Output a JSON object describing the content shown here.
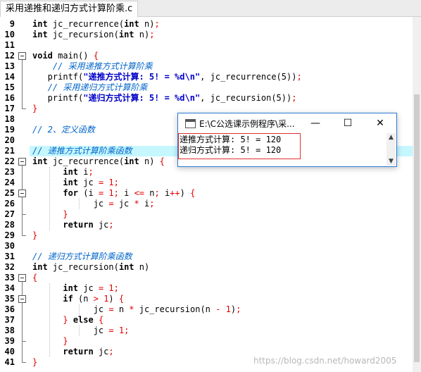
{
  "tab": {
    "title": "采用递推和递归方式计算阶乘.c"
  },
  "code_lines": [
    {
      "n": "9",
      "segs": [
        [
          "kw",
          "int"
        ],
        [
          "t",
          " jc_recurrence("
        ],
        [
          "kw",
          "int"
        ],
        [
          "t",
          " n)"
        ],
        [
          "op",
          ";"
        ]
      ]
    },
    {
      "n": "10",
      "segs": [
        [
          "kw",
          "int"
        ],
        [
          "t",
          " jc_recursion("
        ],
        [
          "kw",
          "int"
        ],
        [
          "t",
          " n)"
        ],
        [
          "op",
          ";"
        ]
      ]
    },
    {
      "n": "11",
      "segs": []
    },
    {
      "n": "12",
      "segs": [
        [
          "kw",
          "void"
        ],
        [
          "t",
          " main() "
        ],
        [
          "op",
          "{"
        ]
      ]
    },
    {
      "n": "13",
      "segs": [
        [
          "t",
          "    "
        ],
        [
          "cmt",
          "// 采用递推方式计算阶乘"
        ]
      ]
    },
    {
      "n": "14",
      "segs": [
        [
          "t",
          "   printf("
        ],
        [
          "str",
          "\"递推方式计算: 5! = %d\\n\""
        ],
        [
          "t",
          ", jc_recurrence(5))"
        ],
        [
          "op",
          ";"
        ]
      ]
    },
    {
      "n": "15",
      "segs": [
        [
          "t",
          "   "
        ],
        [
          "cmt",
          "// 采用递归方式计算阶乘"
        ]
      ]
    },
    {
      "n": "16",
      "segs": [
        [
          "t",
          "   printf("
        ],
        [
          "str",
          "\"递归方式计算: 5! = %d\\n\""
        ],
        [
          "t",
          ", jc_recursion(5))"
        ],
        [
          "op",
          ";"
        ]
      ]
    },
    {
      "n": "17",
      "segs": [
        [
          "op",
          "}"
        ]
      ]
    },
    {
      "n": "18",
      "segs": []
    },
    {
      "n": "19",
      "segs": [
        [
          "cmt",
          "// 2、定义函数"
        ]
      ]
    },
    {
      "n": "20",
      "segs": []
    },
    {
      "n": "21",
      "segs": [
        [
          "cmt",
          "// 递推方式计算阶乘函数"
        ]
      ]
    },
    {
      "n": "22",
      "segs": [
        [
          "kw",
          "int"
        ],
        [
          "t",
          " jc_recurrence("
        ],
        [
          "kw",
          "int"
        ],
        [
          "t",
          " n) "
        ],
        [
          "op",
          "{"
        ]
      ]
    },
    {
      "n": "23",
      "segs": [
        [
          "t",
          "      "
        ],
        [
          "kw",
          "int"
        ],
        [
          "t",
          " i"
        ],
        [
          "op",
          ";"
        ]
      ]
    },
    {
      "n": "24",
      "segs": [
        [
          "t",
          "      "
        ],
        [
          "kw",
          "int"
        ],
        [
          "t",
          " jc "
        ],
        [
          "op",
          "="
        ],
        [
          "t",
          " "
        ],
        [
          "num",
          "1"
        ],
        [
          "op",
          ";"
        ]
      ]
    },
    {
      "n": "25",
      "segs": [
        [
          "t",
          "      "
        ],
        [
          "kw",
          "for"
        ],
        [
          "t",
          " (i "
        ],
        [
          "op",
          "="
        ],
        [
          "t",
          " "
        ],
        [
          "num",
          "1"
        ],
        [
          "op",
          ";"
        ],
        [
          "t",
          " i "
        ],
        [
          "op",
          "<="
        ],
        [
          "t",
          " n"
        ],
        [
          "op",
          ";"
        ],
        [
          "t",
          " i"
        ],
        [
          "op",
          "++"
        ],
        [
          "t",
          ") "
        ],
        [
          "op",
          "{"
        ]
      ]
    },
    {
      "n": "26",
      "segs": [
        [
          "t",
          "            jc "
        ],
        [
          "op",
          "="
        ],
        [
          "t",
          " jc "
        ],
        [
          "op",
          "*"
        ],
        [
          "t",
          " i"
        ],
        [
          "op",
          ";"
        ]
      ]
    },
    {
      "n": "27",
      "segs": [
        [
          "t",
          "      "
        ],
        [
          "op",
          "}"
        ]
      ]
    },
    {
      "n": "28",
      "segs": [
        [
          "t",
          "      "
        ],
        [
          "kw",
          "return"
        ],
        [
          "t",
          " jc"
        ],
        [
          "op",
          ";"
        ]
      ]
    },
    {
      "n": "29",
      "segs": [
        [
          "op",
          "}"
        ]
      ]
    },
    {
      "n": "30",
      "segs": []
    },
    {
      "n": "31",
      "segs": [
        [
          "cmt",
          "// 递归方式计算阶乘函数"
        ]
      ]
    },
    {
      "n": "32",
      "segs": [
        [
          "kw",
          "int"
        ],
        [
          "t",
          " jc_recursion("
        ],
        [
          "kw",
          "int"
        ],
        [
          "t",
          " n)"
        ]
      ]
    },
    {
      "n": "33",
      "segs": [
        [
          "op",
          "{"
        ]
      ]
    },
    {
      "n": "34",
      "segs": [
        [
          "t",
          "      "
        ],
        [
          "kw",
          "int"
        ],
        [
          "t",
          " jc "
        ],
        [
          "op",
          "="
        ],
        [
          "t",
          " "
        ],
        [
          "num",
          "1"
        ],
        [
          "op",
          ";"
        ]
      ]
    },
    {
      "n": "35",
      "segs": [
        [
          "t",
          "      "
        ],
        [
          "kw",
          "if"
        ],
        [
          "t",
          " (n "
        ],
        [
          "op",
          ">"
        ],
        [
          "t",
          " "
        ],
        [
          "num",
          "1"
        ],
        [
          "t",
          ") "
        ],
        [
          "op",
          "{"
        ]
      ]
    },
    {
      "n": "36",
      "segs": [
        [
          "t",
          "            jc "
        ],
        [
          "op",
          "="
        ],
        [
          "t",
          " n "
        ],
        [
          "op",
          "*"
        ],
        [
          "t",
          " jc_recursion(n "
        ],
        [
          "op",
          "-"
        ],
        [
          "t",
          " "
        ],
        [
          "num",
          "1"
        ],
        [
          "t",
          ")"
        ],
        [
          "op",
          ";"
        ]
      ]
    },
    {
      "n": "37",
      "segs": [
        [
          "t",
          "      "
        ],
        [
          "op",
          "}"
        ],
        [
          "t",
          " "
        ],
        [
          "kw",
          "else"
        ],
        [
          "t",
          " "
        ],
        [
          "op",
          "{"
        ]
      ]
    },
    {
      "n": "38",
      "segs": [
        [
          "t",
          "            jc "
        ],
        [
          "op",
          "="
        ],
        [
          "t",
          " "
        ],
        [
          "num",
          "1"
        ],
        [
          "op",
          ";"
        ]
      ]
    },
    {
      "n": "39",
      "segs": [
        [
          "t",
          "      "
        ],
        [
          "op",
          "}"
        ]
      ]
    },
    {
      "n": "40",
      "segs": [
        [
          "t",
          "      "
        ],
        [
          "kw",
          "return"
        ],
        [
          "t",
          " jc"
        ],
        [
          "op",
          ";"
        ]
      ]
    },
    {
      "n": "41",
      "segs": [
        [
          "op",
          "}"
        ]
      ]
    }
  ],
  "console_window": {
    "title": "E:\\C公选课示例程序\\采...",
    "minimize": "—",
    "maximize": "☐",
    "close": "✕",
    "output": [
      "递推方式计算: 5! = 120",
      "递归方式计算: 5! = 120"
    ],
    "scroll_up": "▲",
    "scroll_down": "▼"
  },
  "watermark": "https://blog.csdn.net/howard2005"
}
